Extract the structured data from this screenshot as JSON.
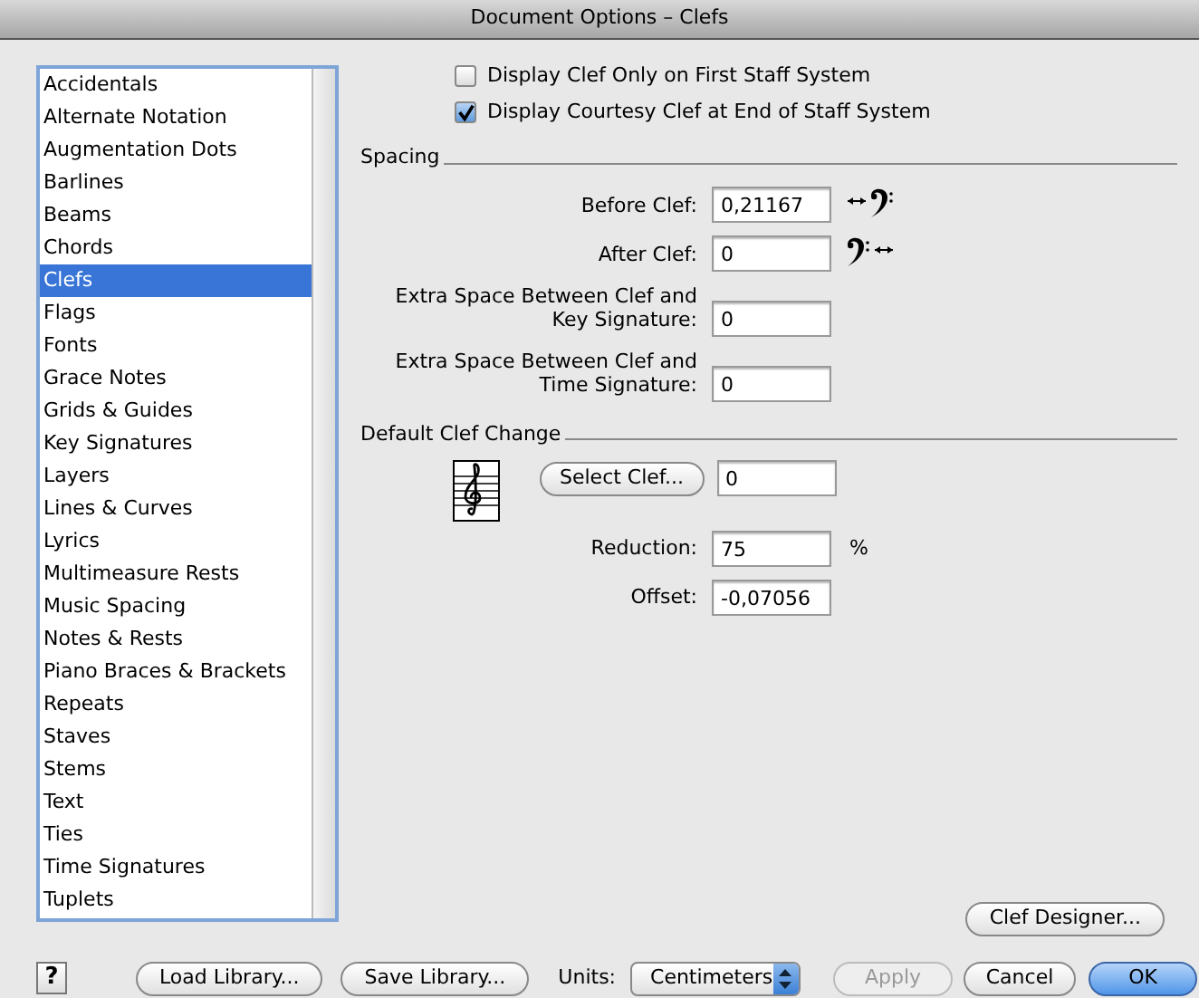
{
  "window": {
    "title": "Document Options – Clefs"
  },
  "sidebar": {
    "items": [
      {
        "label": "Accidentals",
        "selected": false
      },
      {
        "label": "Alternate Notation",
        "selected": false
      },
      {
        "label": "Augmentation Dots",
        "selected": false
      },
      {
        "label": "Barlines",
        "selected": false
      },
      {
        "label": "Beams",
        "selected": false
      },
      {
        "label": "Chords",
        "selected": false
      },
      {
        "label": "Clefs",
        "selected": true
      },
      {
        "label": "Flags",
        "selected": false
      },
      {
        "label": "Fonts",
        "selected": false
      },
      {
        "label": "Grace Notes",
        "selected": false
      },
      {
        "label": "Grids & Guides",
        "selected": false
      },
      {
        "label": "Key Signatures",
        "selected": false
      },
      {
        "label": "Layers",
        "selected": false
      },
      {
        "label": "Lines & Curves",
        "selected": false
      },
      {
        "label": "Lyrics",
        "selected": false
      },
      {
        "label": "Multimeasure Rests",
        "selected": false
      },
      {
        "label": "Music Spacing",
        "selected": false
      },
      {
        "label": "Notes & Rests",
        "selected": false
      },
      {
        "label": "Piano Braces & Brackets",
        "selected": false
      },
      {
        "label": "Repeats",
        "selected": false
      },
      {
        "label": "Staves",
        "selected": false
      },
      {
        "label": "Stems",
        "selected": false
      },
      {
        "label": "Text",
        "selected": false
      },
      {
        "label": "Ties",
        "selected": false
      },
      {
        "label": "Time Signatures",
        "selected": false
      },
      {
        "label": "Tuplets",
        "selected": false
      }
    ]
  },
  "checkboxes": [
    {
      "label": "Display Clef Only on First Staff System",
      "checked": false
    },
    {
      "label": "Display Courtesy Clef at End of Staff System",
      "checked": true
    }
  ],
  "spacing": {
    "title": "Spacing",
    "fields": [
      {
        "label": "Before Clef:",
        "value": "0,21167",
        "kind": "before"
      },
      {
        "label": "After Clef:",
        "value": "0",
        "kind": "after"
      },
      {
        "label": "Extra Space Between Clef and Key Signature:",
        "value": "0",
        "kind": "plain"
      },
      {
        "label": "Extra Space Between Clef and Time Signature:",
        "value": "0",
        "kind": "plain"
      }
    ]
  },
  "default_clef_change": {
    "title": "Default Clef Change",
    "select_button": "Select Clef...",
    "clef_value": "0",
    "reduction": {
      "label": "Reduction:",
      "value": "75",
      "unit": "%"
    },
    "offset": {
      "label": "Offset:",
      "value": "-0,07056"
    }
  },
  "clef_designer_button": "Clef Designer...",
  "help_button": "?",
  "footer": {
    "buttons_left": [
      "Load Library...",
      "Save Library..."
    ],
    "units_label": "Units:",
    "units_value": "Centimeters",
    "buttons_right": [
      {
        "label": "Apply",
        "disabled": true,
        "default": false
      },
      {
        "label": "Cancel",
        "disabled": false,
        "default": false
      },
      {
        "label": "OK",
        "disabled": false,
        "default": true
      }
    ]
  }
}
